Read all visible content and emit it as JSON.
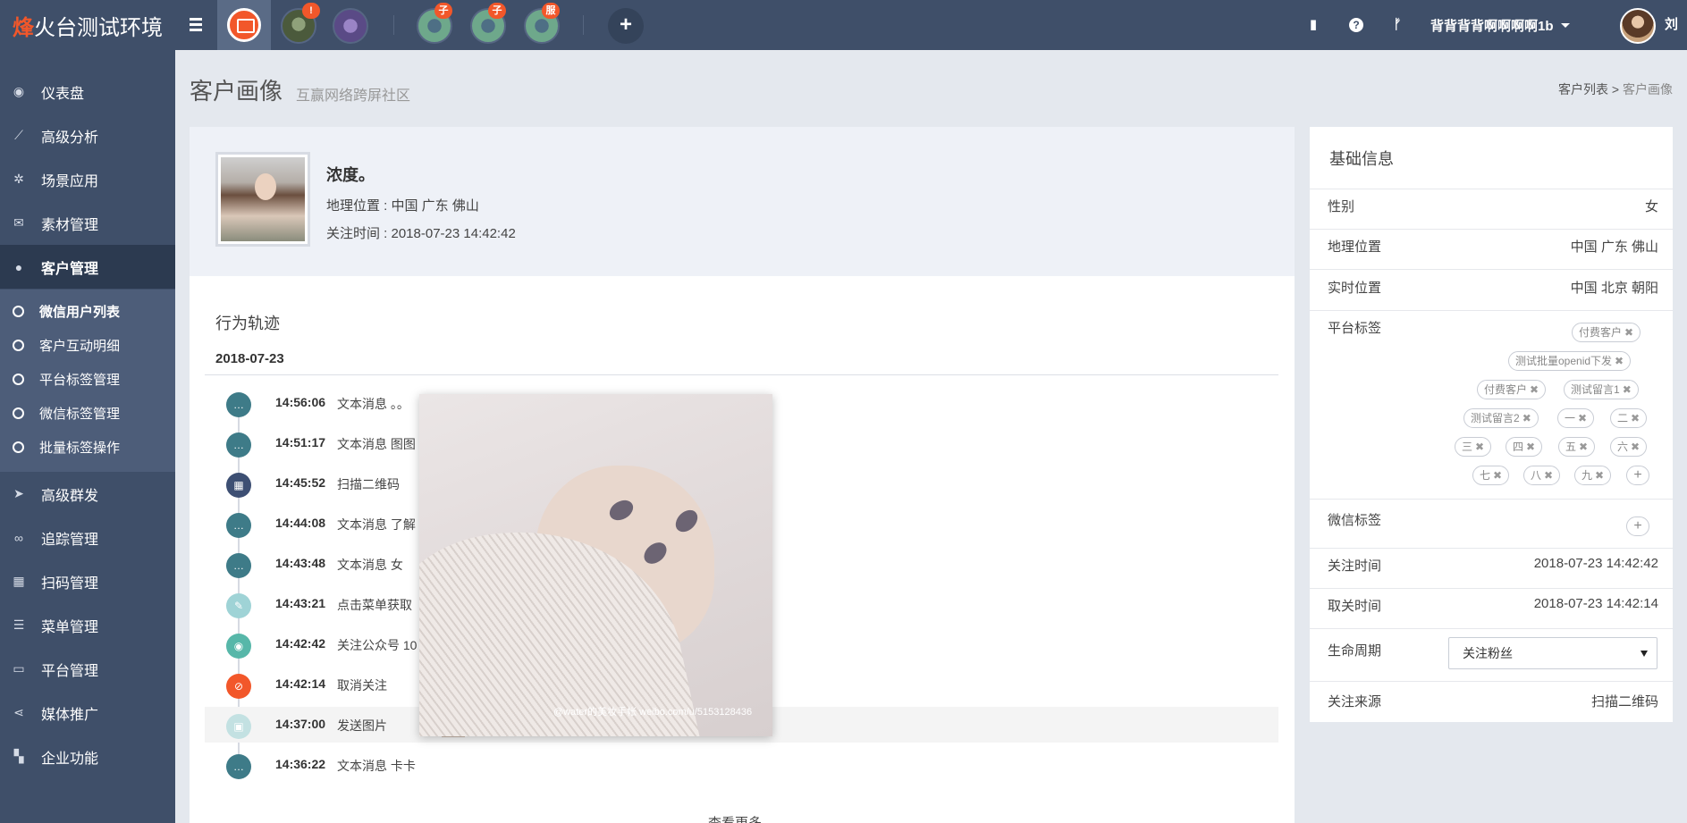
{
  "header": {
    "logo_mark": "烽",
    "logo_rest": "火台测试环境",
    "badges": [
      "!",
      "子",
      "子",
      "服"
    ],
    "plus": "+",
    "icons": [
      "book-icon",
      "help-icon",
      "branch-icon"
    ],
    "help_glyph": "?",
    "user_name": "背背背背啊啊啊啊1b",
    "user_name_cut": "刘"
  },
  "sidebar": {
    "items": [
      {
        "label": "仪表盘",
        "icon": "dashboard-icon",
        "glyph": "◉"
      },
      {
        "label": "高级分析",
        "icon": "line-chart-icon",
        "glyph": "⟋"
      },
      {
        "label": "场景应用",
        "icon": "cog-icon",
        "glyph": "✲"
      },
      {
        "label": "素材管理",
        "icon": "envelope-icon",
        "glyph": "✉"
      },
      {
        "label": "客户管理",
        "icon": "user-icon",
        "glyph": "●"
      },
      {
        "label": "高级群发",
        "icon": "send-icon",
        "glyph": "➤"
      },
      {
        "label": "追踪管理",
        "icon": "link-icon",
        "glyph": "∞"
      },
      {
        "label": "扫码管理",
        "icon": "qrcode-icon",
        "glyph": "▦"
      },
      {
        "label": "菜单管理",
        "icon": "list-icon",
        "glyph": "☰"
      },
      {
        "label": "平台管理",
        "icon": "desktop-icon",
        "glyph": "▭"
      },
      {
        "label": "媒体推广",
        "icon": "share-icon",
        "glyph": "⋖"
      },
      {
        "label": "企业功能",
        "icon": "grid-icon",
        "glyph": "▚"
      }
    ],
    "sub_items": [
      "微信用户列表",
      "客户互动明细",
      "平台标签管理",
      "微信标签管理",
      "批量标签操作"
    ]
  },
  "page": {
    "title": "客户画像",
    "subtitle": "互赢网络跨屏社区",
    "breadcrumb_parent": "客户列表 >",
    "breadcrumb_current": "客户画像"
  },
  "profile": {
    "nickname": "浓度。",
    "location": "地理位置 : 中国 广东 佛山",
    "follow_time": "关注时间 : 2018-07-23 14:42:42"
  },
  "timeline": {
    "title": "行为轨迹",
    "date": "2018-07-23",
    "events": [
      {
        "time": "14:56:06",
        "text": "文本消息 。。",
        "icon": "chat-icon",
        "glyph": "…"
      },
      {
        "time": "14:51:17",
        "text": "文本消息 图图",
        "icon": "chat-icon",
        "glyph": "…"
      },
      {
        "time": "14:45:52",
        "text": "扫描二维码",
        "icon": "qrcode-icon",
        "glyph": "▦"
      },
      {
        "time": "14:44:08",
        "text": "文本消息 了解",
        "icon": "chat-icon",
        "glyph": "…"
      },
      {
        "time": "14:43:48",
        "text": "文本消息 女",
        "icon": "chat-icon",
        "glyph": "…"
      },
      {
        "time": "14:43:21",
        "text": "点击菜单获取",
        "icon": "edit-icon",
        "glyph": "✎"
      },
      {
        "time": "14:42:42",
        "text": "关注公众号 10",
        "icon": "eye-icon",
        "glyph": "◉"
      },
      {
        "time": "14:42:14",
        "text": "取消关注",
        "icon": "eye-slash-icon",
        "glyph": "⊘"
      },
      {
        "time": "14:37:00",
        "text": "发送图片",
        "icon": "image-icon",
        "glyph": "▣"
      },
      {
        "time": "14:36:22",
        "text": "文本消息 卡卡",
        "icon": "chat-icon",
        "glyph": "…"
      }
    ],
    "more": "查看更多",
    "image_watermark": "@water的美妆手帐 weibo.com/u/5153128436"
  },
  "info": {
    "title": "基础信息",
    "gender_label": "性别",
    "gender_value": "女",
    "geo_label": "地理位置",
    "geo_value": "中国 广东 佛山",
    "realtime_label": "实时位置",
    "realtime_value": "中国 北京 朝阳",
    "platform_tags_label": "平台标签",
    "platform_tags": [
      "付费客户",
      "测试批量openid下发",
      "付费客户",
      "测试留言1",
      "测试留言2",
      "一",
      "二",
      "三",
      "四",
      "五",
      "六",
      "七",
      "八",
      "九"
    ],
    "tag_remove": "✖",
    "tag_add": "+",
    "wechat_tags_label": "微信标签",
    "follow_label": "关注时间",
    "follow_value": "2018-07-23 14:42:42",
    "unfollow_label": "取关时间",
    "unfollow_value": "2018-07-23 14:42:14",
    "lifecycle_label": "生命周期",
    "lifecycle_value": "关注粉丝",
    "source_label": "关注来源",
    "source_value": "扫描二维码"
  }
}
